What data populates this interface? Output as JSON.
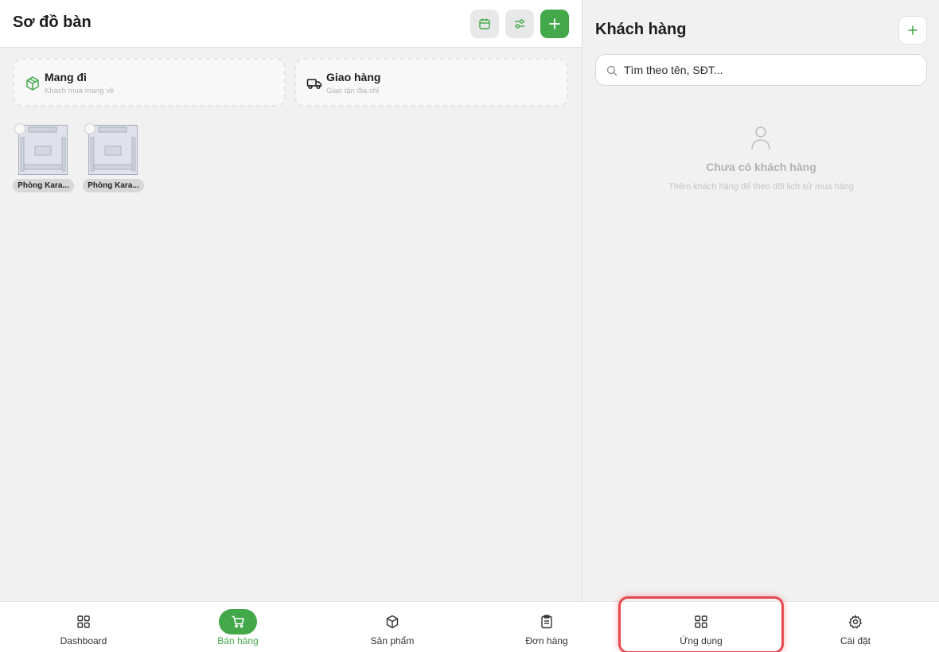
{
  "header": {
    "title": "Sơ đồ bàn",
    "icons": {
      "calendar": "calendar-icon",
      "filter": "sliders-icon",
      "add": "plus-icon"
    }
  },
  "modes": [
    {
      "title": "Mang đi",
      "subtitle": "Khách mua mang về",
      "icon": "package-icon"
    },
    {
      "title": "Giao hàng",
      "subtitle": "Giao tận địa chỉ",
      "icon": "truck-icon"
    }
  ],
  "tables": [
    {
      "label": "Phòng Kara..."
    },
    {
      "label": "Phòng Kara..."
    }
  ],
  "customers": {
    "title": "Khách hàng",
    "search_placeholder": "Tìm theo tên, SĐT...",
    "empty_title": "Chưa có khách hàng",
    "empty_subtitle": "Thêm khách hàng để theo dõi lịch sử mua hàng"
  },
  "nav": {
    "items": [
      {
        "label": "Dashboard",
        "icon": "grid-icon"
      },
      {
        "label": "Bán hàng",
        "icon": "cart-icon",
        "active": true
      },
      {
        "label": "Sản phẩm",
        "icon": "box-icon"
      },
      {
        "label": "Đơn hàng",
        "icon": "clipboard-icon"
      },
      {
        "label": "Ứng dụng",
        "icon": "apps-icon",
        "highlighted": true
      },
      {
        "label": "Cài đặt",
        "icon": "settings-icon"
      }
    ]
  },
  "colors": {
    "accent": "#43a84a",
    "highlight": "#e64a4f",
    "background": "#f1f1f1"
  }
}
